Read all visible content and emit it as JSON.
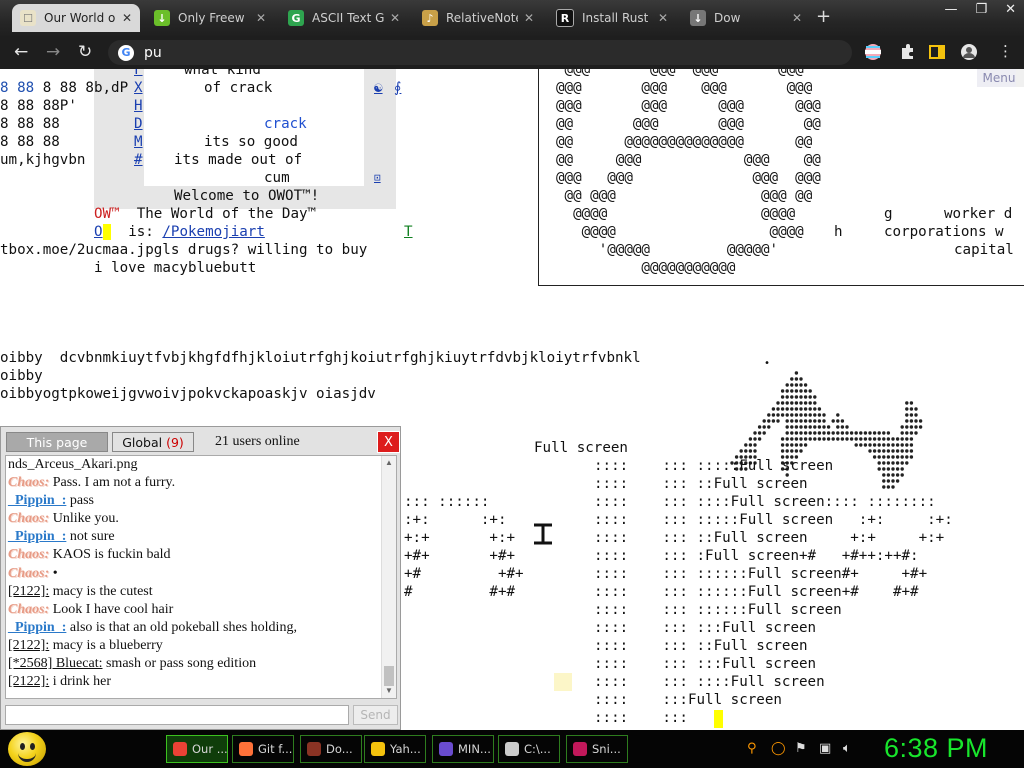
{
  "browser": {
    "tabs": [
      {
        "title": "Our World o",
        "active": true
      },
      {
        "title": "Only Freew",
        "active": false
      },
      {
        "title": "ASCII Text G",
        "active": false
      },
      {
        "title": "RelativeNote",
        "active": false
      },
      {
        "title": "Install Rust",
        "active": false
      },
      {
        "title": "Dow",
        "active": false
      }
    ],
    "address": "pu",
    "new_tab": "+",
    "window_buttons": [
      "—",
      "❐",
      "✕"
    ]
  },
  "page": {
    "menu_label": "Menu",
    "left_lines": [
      "8 88 8b,dP",
      "8 88 88P'",
      "8 88 88",
      "8 88 88",
      "um,kjhgvbn"
    ],
    "center_box_lines": [
      "what kind",
      "of crack",
      "",
      "crack",
      "its so good",
      "its made out of",
      "cum"
    ],
    "col_left_letters": [
      "F",
      "X",
      "H",
      "D",
      "M",
      "#"
    ],
    "col_right_glyphs": [
      "☯",
      "∮"
    ],
    "welcome": "Welcome to OWOT™!",
    "wotd_prefix": "OW™",
    "wotd_title": "The World of the Day™",
    "wotd_is": "is:",
    "wotd_link": "/Pokemojiart",
    "wotd_t": "T",
    "wotd_o": "O",
    "url_line": "tbox.moe/2ucmaa.jpgls drugs? willing to buy",
    "macy_line": "i love macybluebutt",
    "right_art": [
      " @@@       @@@  @@@       @@@",
      "@@@       @@@    @@@       @@@",
      "@@@       @@@      @@@      @@@",
      "@@       @@@       @@@       @@",
      "@@      @@@@@@@@@@@@@@      @@",
      "@@     @@@            @@@    @@",
      "@@@   @@@              @@@  @@@",
      " @@ @@@                 @@@ @@",
      "  @@@@                  @@@@",
      "   @@@@                  @@@@",
      "     '@@@@@         @@@@@'",
      "          @@@@@@@@@@@"
    ],
    "right_words": {
      "g": "g",
      "worker": "worker d",
      "h": "h",
      "corporations": "corporations w",
      "capital": "capital"
    },
    "bibby_lines": [
      "oibby  dcvbnmkiuytfvbjkhgfdfhjkloiutrfghjkoiutrfghjkiuytrfdvbjkloiytrfvbnkl",
      "oibby",
      "oibbyogtpkoweijgvwoivjpokvckapoaskjv oiasjdv"
    ],
    "full_screen_title": "Full screen",
    "full_screen_rows": [
      "::::    ::: :::::Full screen",
      "::::    ::: ::Full screen",
      "::::    ::: ::::Full screen:::: ::::::::",
      "::::    ::: :::::Full screen   :+:     :+:",
      "::::    ::: ::Full screen     +:+     +:+",
      "::::    ::: :Full screen+#   +#++:++#:",
      "::::    ::: ::::::Full screen#+     +#+",
      "::::    ::: ::::::Full screen+#    #+#",
      "::::    ::: ::::::Full screen",
      "::::    ::: :::Full screen",
      "::::    ::: ::Full screen",
      "::::    ::: :::Full screen",
      "::::    ::: ::::Full screen",
      "::::    :::Full screen",
      "::::    :::"
    ],
    "left_art": [
      "::: ::::::",
      ":+:      :+:",
      "+:+       +:+",
      "+#+       +#+",
      "+#         +#+",
      "#         #+#"
    ]
  },
  "chat": {
    "tab_this_page": "This page",
    "tab_global": "Global",
    "global_count": "(9)",
    "users_online": "21 users online",
    "close": "X",
    "messages": [
      {
        "name": "",
        "type": "none",
        "text": "nds_Arceus_Akari.png"
      },
      {
        "name": "Chaos:",
        "type": "chaos",
        "text": "Pass. I am not a furry."
      },
      {
        "name": "_Pippin_:",
        "type": "pippin",
        "text": "pass"
      },
      {
        "name": "Chaos:",
        "type": "chaos",
        "text": "Unlike you."
      },
      {
        "name": "_Pippin_:",
        "type": "pippin",
        "text": "not sure"
      },
      {
        "name": "Chaos:",
        "type": "chaos",
        "text": "KAOS is fuckin bald"
      },
      {
        "name": "Chaos:",
        "type": "chaos",
        "text": "•"
      },
      {
        "name": "[2122]:",
        "type": "num",
        "text": "macy is the cutest"
      },
      {
        "name": "Chaos:",
        "type": "chaos",
        "text": "Look I have cool hair"
      },
      {
        "name": "_Pippin_:",
        "type": "pippin",
        "text": "also is that an old pokeball shes holding,"
      },
      {
        "name": "[2122]:",
        "type": "num",
        "text": "macy is a blueberry"
      },
      {
        "name": "[*2568] Bluecat:",
        "type": "num",
        "text": "smash or pass song edition"
      },
      {
        "name": "[2122]:",
        "type": "num",
        "text": "i drink her"
      }
    ],
    "input_value": "",
    "send_label": "Send"
  },
  "taskbar": {
    "tasks": [
      {
        "label": "Our ...",
        "color": "#e94235",
        "active": true
      },
      {
        "label": "Git f...",
        "color": "#ff7139",
        "active": false
      },
      {
        "label": "Do...",
        "color": "#8a3324",
        "active": false
      },
      {
        "label": "Yah...",
        "color": "#f4c20d",
        "active": false
      },
      {
        "label": "MIN...",
        "color": "#6a4ccf",
        "active": false
      },
      {
        "label": "C:\\...",
        "color": "#cccccc",
        "active": false
      },
      {
        "label": "Sni...",
        "color": "#c2185b",
        "active": false
      }
    ],
    "clock": "6:38 PM",
    "colors": {
      "clock": "#18e62c",
      "task_border": "#3cc21f"
    }
  }
}
